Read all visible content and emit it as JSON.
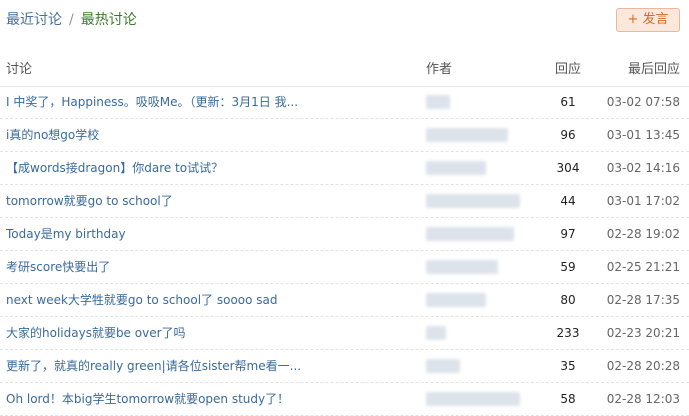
{
  "tabs": {
    "recent": "最近讨论",
    "separator": "/",
    "hot": "最热讨论"
  },
  "post_button": {
    "icon": "+",
    "label": "发言"
  },
  "table": {
    "headers": {
      "title": "讨论",
      "author": "作者",
      "replies": "回应",
      "last": "最后回应"
    },
    "rows": [
      {
        "title": "I 中奖了，Happiness。吸吸Me。（更新：3月1日 我...",
        "replies": "61",
        "last": "03-02 07:58"
      },
      {
        "title": "i真的no想go学校",
        "replies": "96",
        "last": "03-01 13:45"
      },
      {
        "title": "【成words接dragon】你dare to试试？",
        "replies": "304",
        "last": "03-02 14:16"
      },
      {
        "title": "tomorrow就要go to school了",
        "replies": "44",
        "last": "03-01 17:02"
      },
      {
        "title": "Today是my birthday",
        "replies": "97",
        "last": "02-28 19:02"
      },
      {
        "title": "考研score快要出了",
        "replies": "59",
        "last": "02-25 21:21"
      },
      {
        "title": "next week大学牲就要go to school了 soooo sad",
        "replies": "80",
        "last": "02-28 17:35"
      },
      {
        "title": "大家的holidays就要be over了吗",
        "replies": "233",
        "last": "02-23 20:21"
      },
      {
        "title": "更新了，就真的really green|请各位sister帮me看一...",
        "replies": "35",
        "last": "02-28 20:28"
      },
      {
        "title": "Oh lord！本big学生tomorrow就要open study了！",
        "replies": "58",
        "last": "02-28 12:03"
      }
    ]
  }
}
